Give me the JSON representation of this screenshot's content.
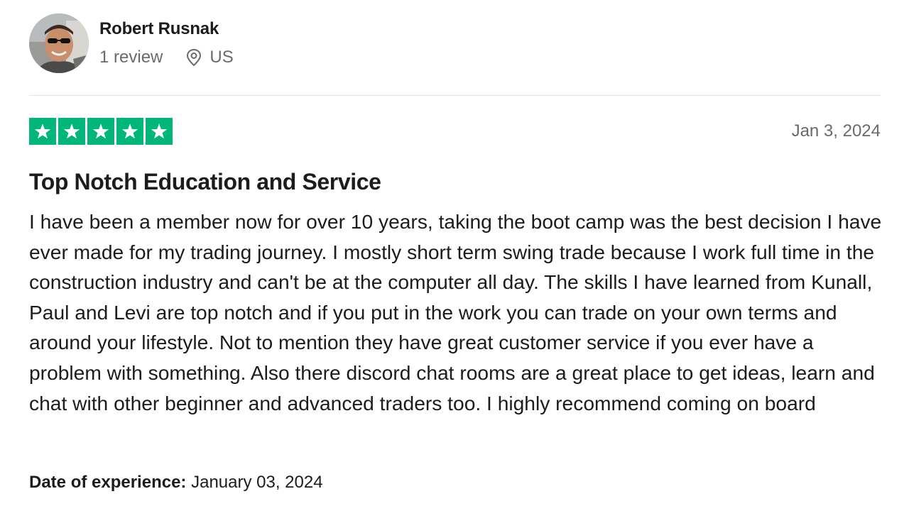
{
  "reviewer": {
    "name": "Robert Rusnak",
    "review_count": "1 review",
    "country": "US",
    "avatar_icon": "reviewer-avatar-photo"
  },
  "rating": {
    "stars": 5,
    "max": 5,
    "star_color": "#00b67a",
    "icon": "star-icon"
  },
  "review": {
    "date": "Jan 3, 2024",
    "title": "Top Notch Education and Service",
    "text": "I have been a member now for over 10 years, taking the boot camp was the best decision I have ever made for my trading journey. I mostly short term swing trade because I work full time in the construction industry and can't be at the computer all day. The skills I have learned from Kunall, Paul and Levi are top notch and if you put in the work you can trade on your own terms and around your lifestyle. Not to mention they have great customer service if you ever have a problem with something. Also there discord chat rooms are a great place to get ideas, learn and chat with other beginner and advanced traders too. I highly recommend coming on board",
    "experience_label": "Date of experience:",
    "experience_date": "January 03, 2024"
  },
  "icons": {
    "location": "location-pin-icon"
  }
}
